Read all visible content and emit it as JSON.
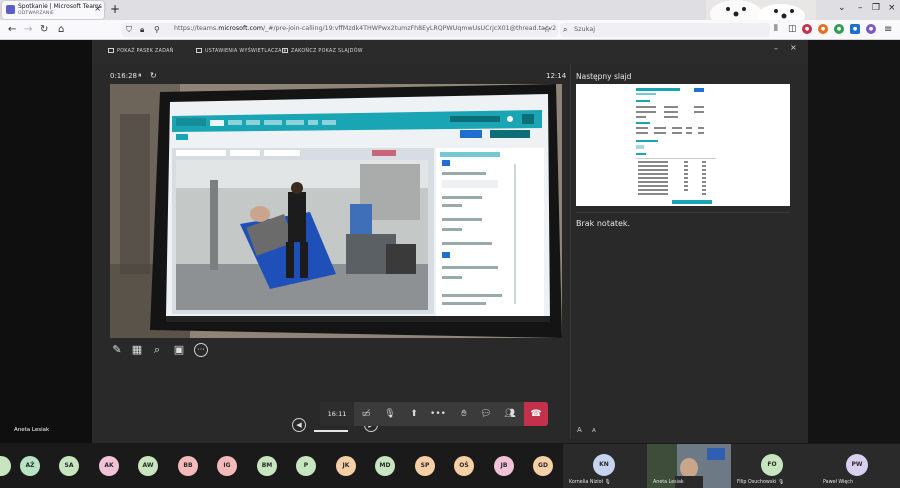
{
  "browser": {
    "tab_title": "Spotkanie | Microsoft Teams",
    "tab_status": "ODTWARZANIE",
    "url_prefix": "https://teams.",
    "url_domain": "microsoft.com",
    "url_rest": "/_#/pre-join-calling/19:vffMzdk4THWPwx2tumzFh8EyLRQPWUqmwUsUCrjcX01@thread.tacv2",
    "search_placeholder": "Szukaj"
  },
  "toolbar": {
    "show_taskbar": "POKAŻ PASEK ZADAŃ",
    "display_settings": "USTAWIENIA WYŚWIETLACZA ▾",
    "end_show": "ZAKOŃCZ POKAZ SLAJDÓW"
  },
  "presentation": {
    "elapsed": "0:16:28",
    "clock": "12:14",
    "next_slide_label": "Następny slajd",
    "no_notes": "Brak notatek.",
    "font_smaller": "A",
    "font_larger": "A"
  },
  "presenter_name": "Aneta Lesiak",
  "callbar": {
    "duration": "16:11"
  },
  "participants": [
    {
      "initials": "AŻ",
      "color": "#b9e3c5"
    },
    {
      "initials": "SA",
      "color": "#c7e6c0"
    },
    {
      "initials": "AK",
      "color": "#f2c3d8"
    },
    {
      "initials": "AW",
      "color": "#c7e6c0"
    },
    {
      "initials": "BB",
      "color": "#f4b9b9"
    },
    {
      "initials": "IG",
      "color": "#f4b9b9"
    },
    {
      "initials": "BM",
      "color": "#c7e6c0"
    },
    {
      "initials": "P",
      "color": "#c7e6c0"
    },
    {
      "initials": "JK",
      "color": "#f5cfa6"
    },
    {
      "initials": "MD",
      "color": "#c7e6c0"
    },
    {
      "initials": "SP",
      "color": "#f5cfa6"
    },
    {
      "initials": "OŚ",
      "color": "#f5cfa6"
    },
    {
      "initials": "JB",
      "color": "#f2c3d8"
    },
    {
      "initials": "GD",
      "color": "#f5cfa6"
    }
  ],
  "tiles": [
    {
      "initials": "KN",
      "name": "Kornelia Nizioł",
      "color": "#c5d5ef"
    },
    {
      "initials": "",
      "name": "Aneta Lesiak",
      "color": "#444"
    },
    {
      "initials": "FO",
      "name": "Filip Osuchowski",
      "color": "#c7e6c0"
    },
    {
      "initials": "PW",
      "name": "Paweł Więch",
      "color": "#d9d0ef"
    }
  ],
  "colors": {
    "hangup": "#c4314b",
    "teams_purple": "#5b5fc7",
    "app_teal": "#17a2b8"
  }
}
